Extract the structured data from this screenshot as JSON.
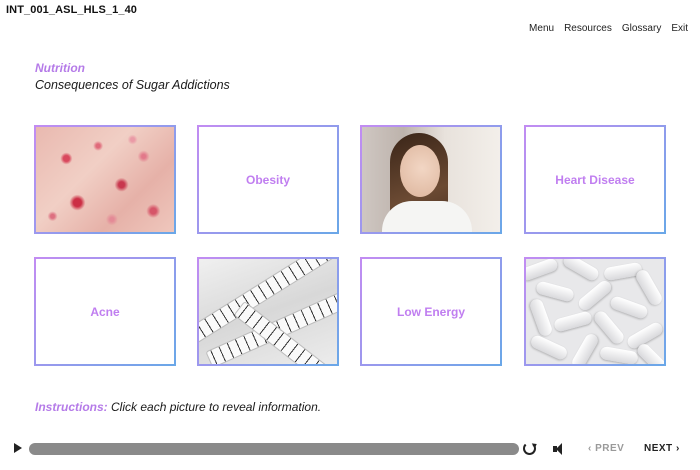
{
  "course_id": "INT_001_ASL_HLS_1_40",
  "nav": {
    "menu": "Menu",
    "resources": "Resources",
    "glossary": "Glossary",
    "exit": "Exit"
  },
  "section_title": "Nutrition",
  "page_subtitle": "Consequences of Sugar Addictions",
  "tiles": [
    {
      "type": "image",
      "image": "acne-skin-photo"
    },
    {
      "type": "label",
      "label": "Obesity"
    },
    {
      "type": "image",
      "image": "tired-woman-photo"
    },
    {
      "type": "label",
      "label": "Heart Disease"
    },
    {
      "type": "label",
      "label": "Acne"
    },
    {
      "type": "image",
      "image": "measuring-tape-photo"
    },
    {
      "type": "label",
      "label": "Low Energy"
    },
    {
      "type": "image",
      "image": "white-pills-photo"
    }
  ],
  "instructions": {
    "label": "Instructions:",
    "text": "Click each picture to reveal information."
  },
  "playbar": {
    "prev": "‹ PREV",
    "next": "NEXT ›"
  },
  "colors": {
    "accent_purple": "#b57be8",
    "tile_border_start": "#c28cf2",
    "tile_border_end": "#6aa7e8",
    "scrubber": "#8a8a8a"
  }
}
